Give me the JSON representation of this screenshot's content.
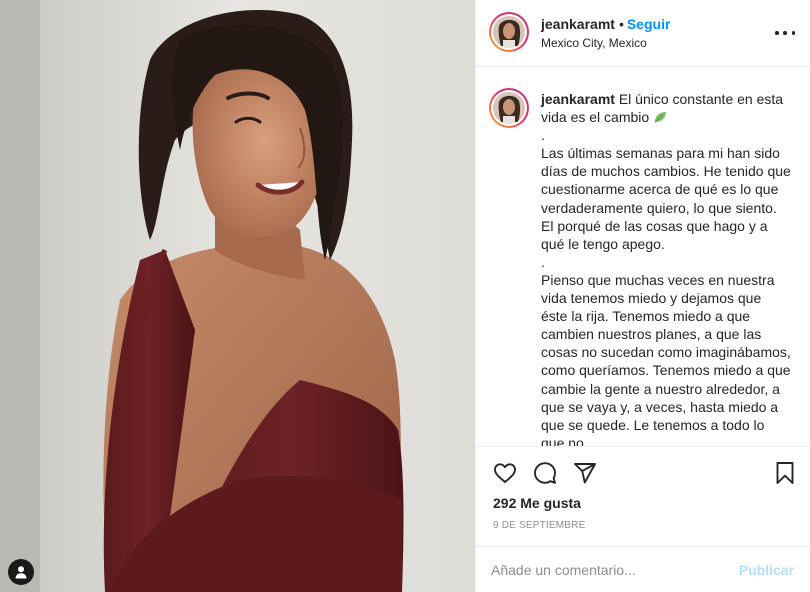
{
  "post": {
    "username": "jeankaramt",
    "follow_label": "Seguir",
    "separator": "•",
    "location": "Mexico City, Mexico"
  },
  "caption": {
    "username": "jeankaramt",
    "lines": [
      "El único constante en esta vida es el cambio",
      ".",
      "Las últimas semanas para mi han sido días de muchos cambios. He tenido que cuestionarme acerca de qué es lo que verdaderamente quiero, lo que siento. El porqué de las cosas que hago y a qué le tengo apego.",
      ".",
      "Pienso que muchas veces en nuestra vida tenemos miedo y dejamos que éste la rija. Tenemos miedo a que cambien nuestros planes, a que las cosas no sucedan como imaginábamos, como queríamos. Tenemos miedo a que cambie la gente a nuestro alrededor, a que se vaya y, a veces, hasta miedo a que se quede. Le tenemos a todo lo que no"
    ]
  },
  "engagement": {
    "likes": "292 Me gusta",
    "date": "9 DE SEPTIEMBRE"
  },
  "comment_box": {
    "placeholder": "Añade un comentario...",
    "publish_label": "Publicar"
  },
  "colors": {
    "link_blue": "#0095f6",
    "publish_disabled": "#b2dffc",
    "text": "#262626",
    "muted": "#8e8e8e"
  },
  "icons": {
    "like": "heart-icon",
    "comment": "comment-bubble-icon",
    "share": "paper-plane-icon",
    "save": "bookmark-icon",
    "more": "more-options-icon",
    "tags": "user-tag-icon",
    "emoji": "leaf-emoji-icon"
  }
}
